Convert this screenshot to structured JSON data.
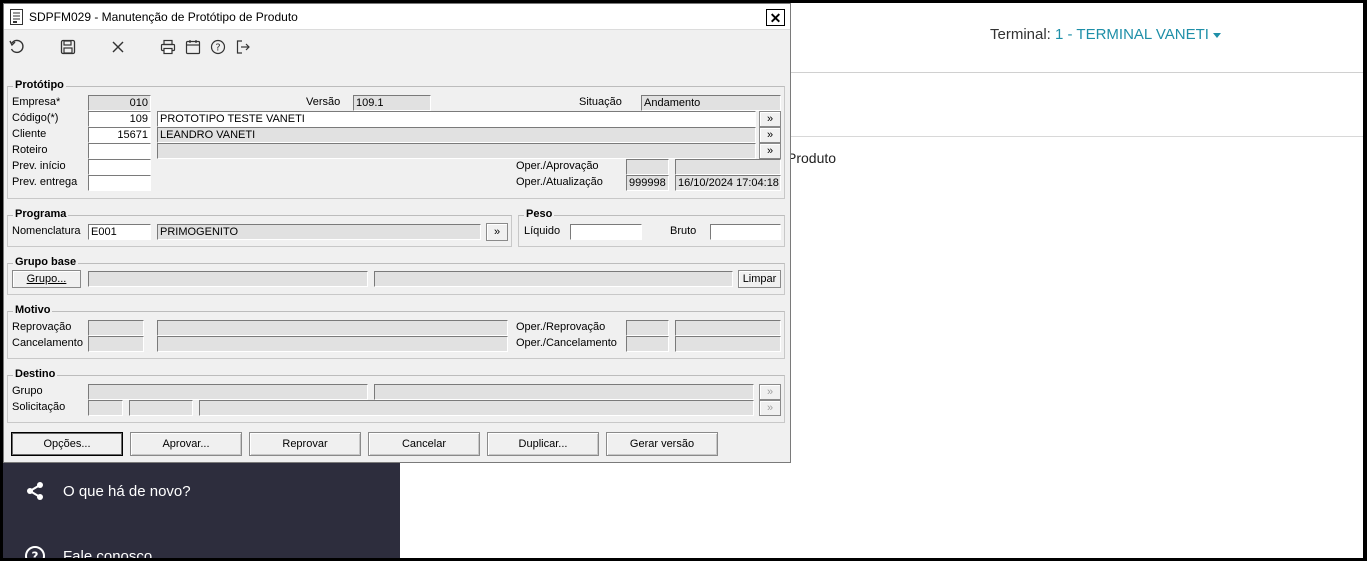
{
  "background": {
    "terminal_label": "Terminal:",
    "terminal_value": "1 - TERMINAL VANETI",
    "produto_text": "Produto",
    "sidebar_items": [
      {
        "label": "O que há de novo?",
        "icon": "share-icon"
      },
      {
        "label": "Fale conosco",
        "icon": "help-circle-icon"
      }
    ]
  },
  "dialog": {
    "title": "SDPFM029 - Manutenção de Protótipo de Produto",
    "close_label": "✕",
    "toolbar_icons": [
      "undo-icon",
      "save-icon",
      "cancel-icon",
      "print-icon",
      "calendar-icon",
      "help-icon",
      "exit-icon"
    ]
  },
  "prototipo": {
    "legend": "Protótipo",
    "empresa_label": "Empresa*",
    "empresa_value": "010",
    "versao_label": "Versão",
    "versao_value": "109.1",
    "situacao_label": "Situação",
    "situacao_value": "Andamento",
    "codigo_label": "Código(*)",
    "codigo_value": "109",
    "codigo_desc": "PROTOTIPO TESTE VANETI",
    "cliente_label": "Cliente",
    "cliente_value": "15671",
    "cliente_desc": "LEANDRO VANETI",
    "roteiro_label": "Roteiro",
    "roteiro_value": "",
    "prev_inicio_label": "Prev. início",
    "prev_entrega_label": "Prev. entrega",
    "oper_aprov_label": "Oper./Aprovação",
    "oper_atual_label": "Oper./Atualização",
    "oper_atual_code": "999998",
    "oper_atual_date": "16/10/2024 17:04:18",
    "lookup_label": "»"
  },
  "programa": {
    "legend": "Programa",
    "nomenclatura_label": "Nomenclatura",
    "nomenclatura_value": "E001",
    "nomenclatura_desc": "PRIMOGENITO"
  },
  "peso": {
    "legend": "Peso",
    "liquido_label": "Líquido",
    "bruto_label": "Bruto"
  },
  "grupo_base": {
    "legend": "Grupo base",
    "grupo_button": "Grupo...",
    "limpar_button": "Limpar"
  },
  "motivo": {
    "legend": "Motivo",
    "reprovacao_label": "Reprovação",
    "cancelamento_label": "Cancelamento",
    "oper_reprov_label": "Oper./Reprovação",
    "oper_cancel_label": "Oper./Cancelamento"
  },
  "destino": {
    "legend": "Destino",
    "grupo_label": "Grupo",
    "solicitacao_label": "Solicitação"
  },
  "buttons": {
    "opcoes": "Opções...",
    "aprovar": "Aprovar...",
    "reprovar": "Reprovar",
    "cancelar": "Cancelar",
    "duplicar": "Duplicar...",
    "gerar_versao": "Gerar versão"
  }
}
